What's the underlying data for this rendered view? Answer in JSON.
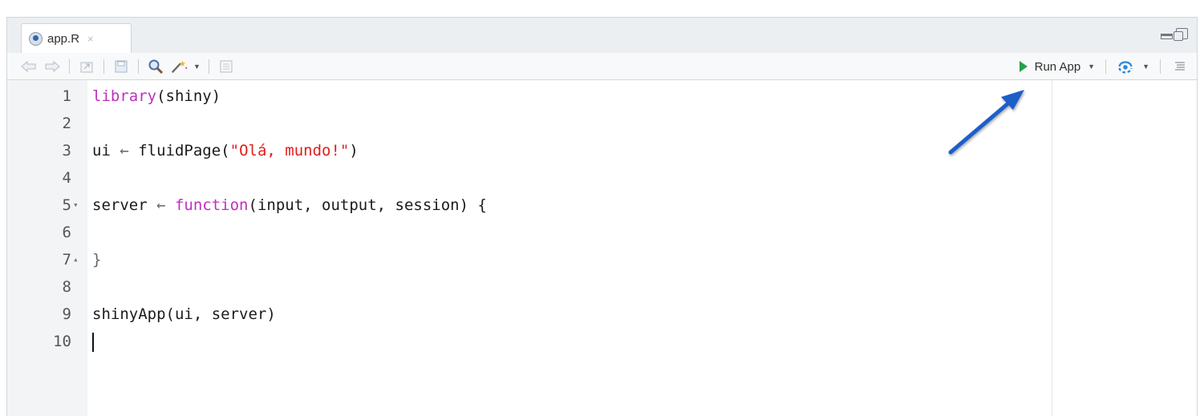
{
  "tab": {
    "filename": "app.R",
    "close_symbol": "×"
  },
  "toolbar": {
    "run_label": "Run App",
    "run_color": "#24a24a",
    "icons": [
      "back-arrow-icon",
      "forward-arrow-icon",
      "show-in-window-icon",
      "save-icon",
      "search-icon",
      "magic-wand-icon",
      "compile-report-icon",
      "publish-icon",
      "outline-icon"
    ]
  },
  "editor": {
    "lines": [
      {
        "n": "1",
        "fold": "",
        "tokens": [
          {
            "t": "library",
            "c": "kw"
          },
          {
            "t": "(shiny)",
            "c": ""
          }
        ]
      },
      {
        "n": "2",
        "fold": "",
        "tokens": []
      },
      {
        "n": "3",
        "fold": "",
        "tokens": [
          {
            "t": "ui ",
            "c": ""
          },
          {
            "t": "←",
            "c": "op"
          },
          {
            "t": " fluidPage(",
            "c": ""
          },
          {
            "t": "\"Olá, mundo!\"",
            "c": "str"
          },
          {
            "t": ")",
            "c": ""
          }
        ]
      },
      {
        "n": "4",
        "fold": "",
        "tokens": []
      },
      {
        "n": "5",
        "fold": "▾",
        "tokens": [
          {
            "t": "server ",
            "c": ""
          },
          {
            "t": "←",
            "c": "op"
          },
          {
            "t": " ",
            "c": ""
          },
          {
            "t": "function",
            "c": "kw"
          },
          {
            "t": "(input, output, session) {",
            "c": ""
          }
        ]
      },
      {
        "n": "6",
        "fold": "",
        "tokens": []
      },
      {
        "n": "7",
        "fold": "▴",
        "tokens": [
          {
            "t": "}",
            "c": "op"
          }
        ]
      },
      {
        "n": "8",
        "fold": "",
        "tokens": []
      },
      {
        "n": "9",
        "fold": "",
        "tokens": [
          {
            "t": "shinyApp(ui, server)",
            "c": ""
          }
        ]
      },
      {
        "n": "10",
        "fold": "",
        "tokens": [],
        "cursor": true
      }
    ]
  },
  "annotation": {
    "arrow_color": "#1f5fc9"
  }
}
